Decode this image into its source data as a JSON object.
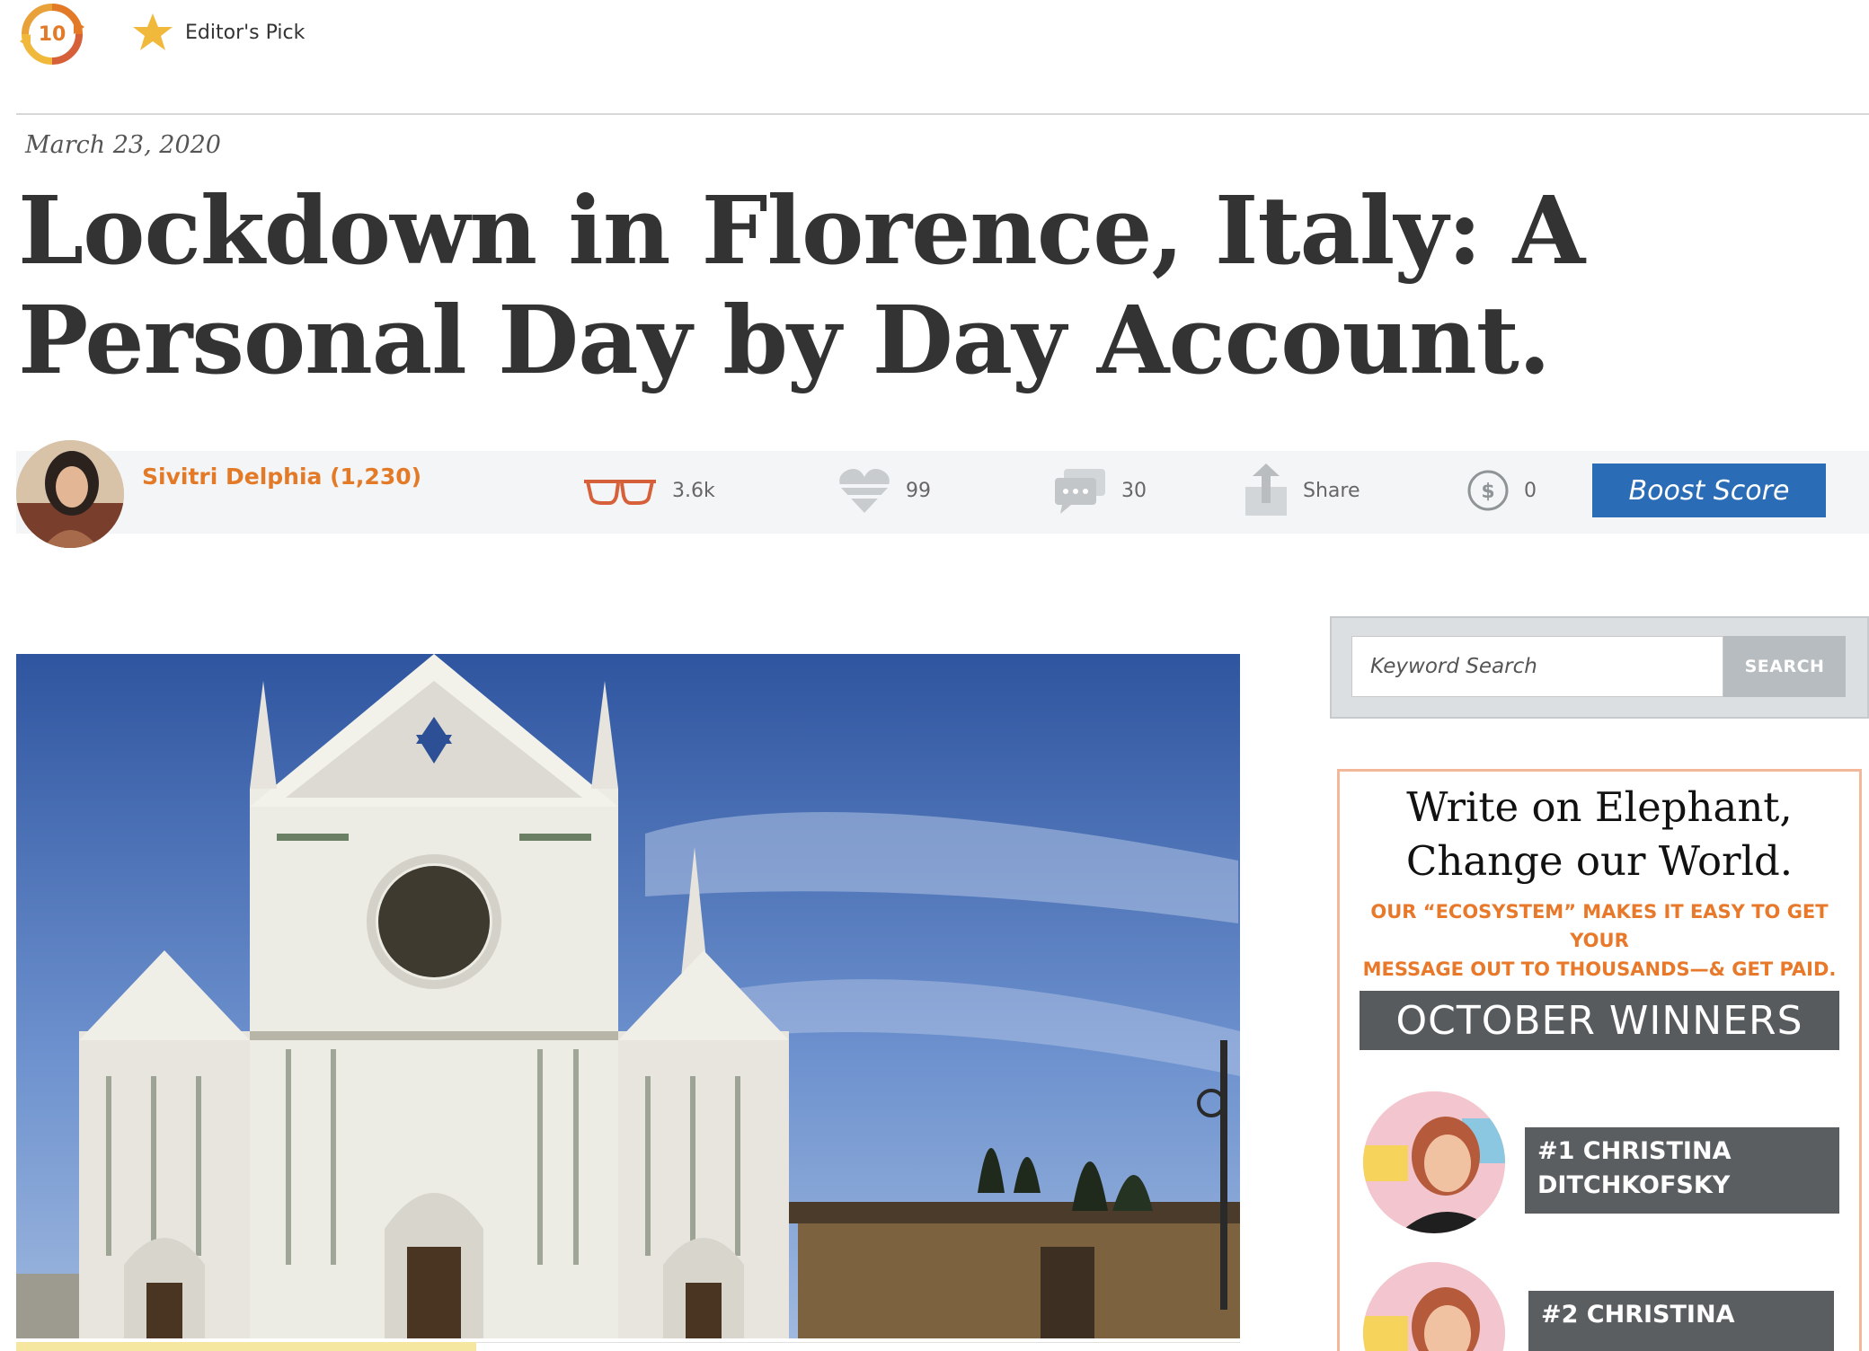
{
  "top_bar": {
    "score_value": "10",
    "editors_pick_label": "Editor's Pick"
  },
  "article": {
    "date": "March 23, 2020",
    "title": "Lockdown in Florence, Italy: A Personal Day by Day Account."
  },
  "stats": {
    "author": "Sivitri Delphia (1,230)",
    "reads": "3.6k",
    "hearts": "99",
    "comments": "30",
    "share_label": "Share",
    "tips": "0",
    "boost_label": "Boost Score"
  },
  "search": {
    "placeholder": "Keyword Search",
    "button_label": "SEARCH"
  },
  "ad": {
    "title_line1": "Write on Elephant,",
    "title_line2": "Change our World.",
    "subtitle_line1": "OUR “ECOSYSTEM” MAKES IT EASY TO GET YOUR",
    "subtitle_line2": "MESSAGE OUT TO THOUSANDS—& GET PAID.",
    "banner": "OCTOBER WINNERS",
    "winners": [
      {
        "line1": "#1 CHRISTINA",
        "line2": "DITCHKOFSKY"
      },
      {
        "line1": "#2 CHRISTINA",
        "line2": ""
      }
    ]
  },
  "colors": {
    "accent_orange": "#e37a27",
    "boost_blue": "#2a6db6",
    "star_gold": "#f0b93b",
    "stats_bg": "#f4f5f6"
  },
  "icons": [
    "score-refresh-icon",
    "star-icon",
    "glasses-icon",
    "heart-icon",
    "comment-icon",
    "share-icon",
    "dollar-icon"
  ]
}
